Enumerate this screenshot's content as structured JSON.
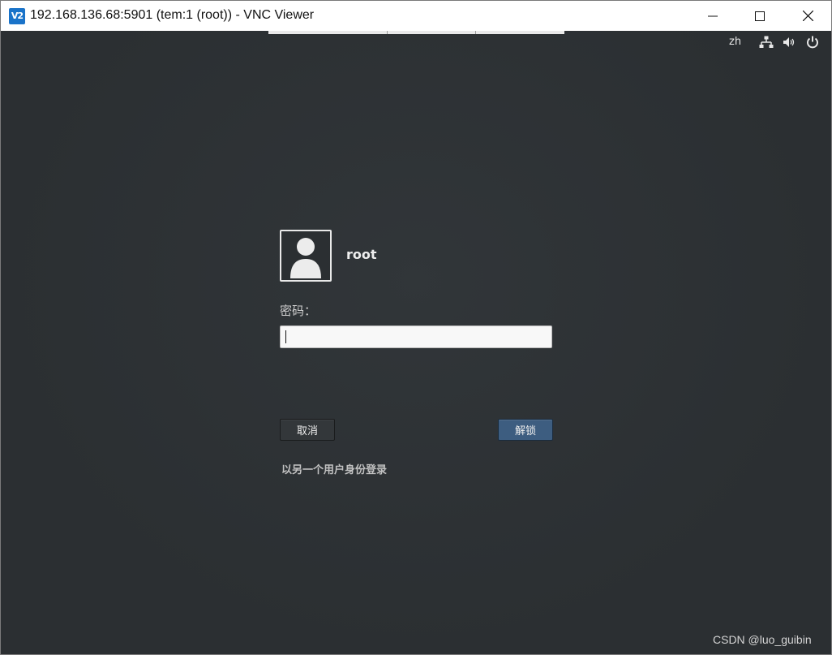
{
  "window": {
    "title": "192.168.136.68:5901 (tem:1 (root)) - VNC Viewer",
    "app_icon_text": "V2",
    "controls": [
      "minimize-icon",
      "maximize-icon",
      "close-icon"
    ]
  },
  "topbar": {
    "language": "zh",
    "icons": [
      "network-icon",
      "volume-icon",
      "power-icon"
    ]
  },
  "lock_screen": {
    "user_icon": "user-avatar-icon",
    "username": "root",
    "password_label": "密码：",
    "password_value": "",
    "cancel_label": "取消",
    "unlock_label": "解锁",
    "switch_user_label": "以另一个用户身份登录"
  },
  "watermark": "CSDN @luo_guibin",
  "colors": {
    "background": "#2b2f32",
    "unlock_button": "#3d5d80",
    "text": "#eeeeee"
  }
}
